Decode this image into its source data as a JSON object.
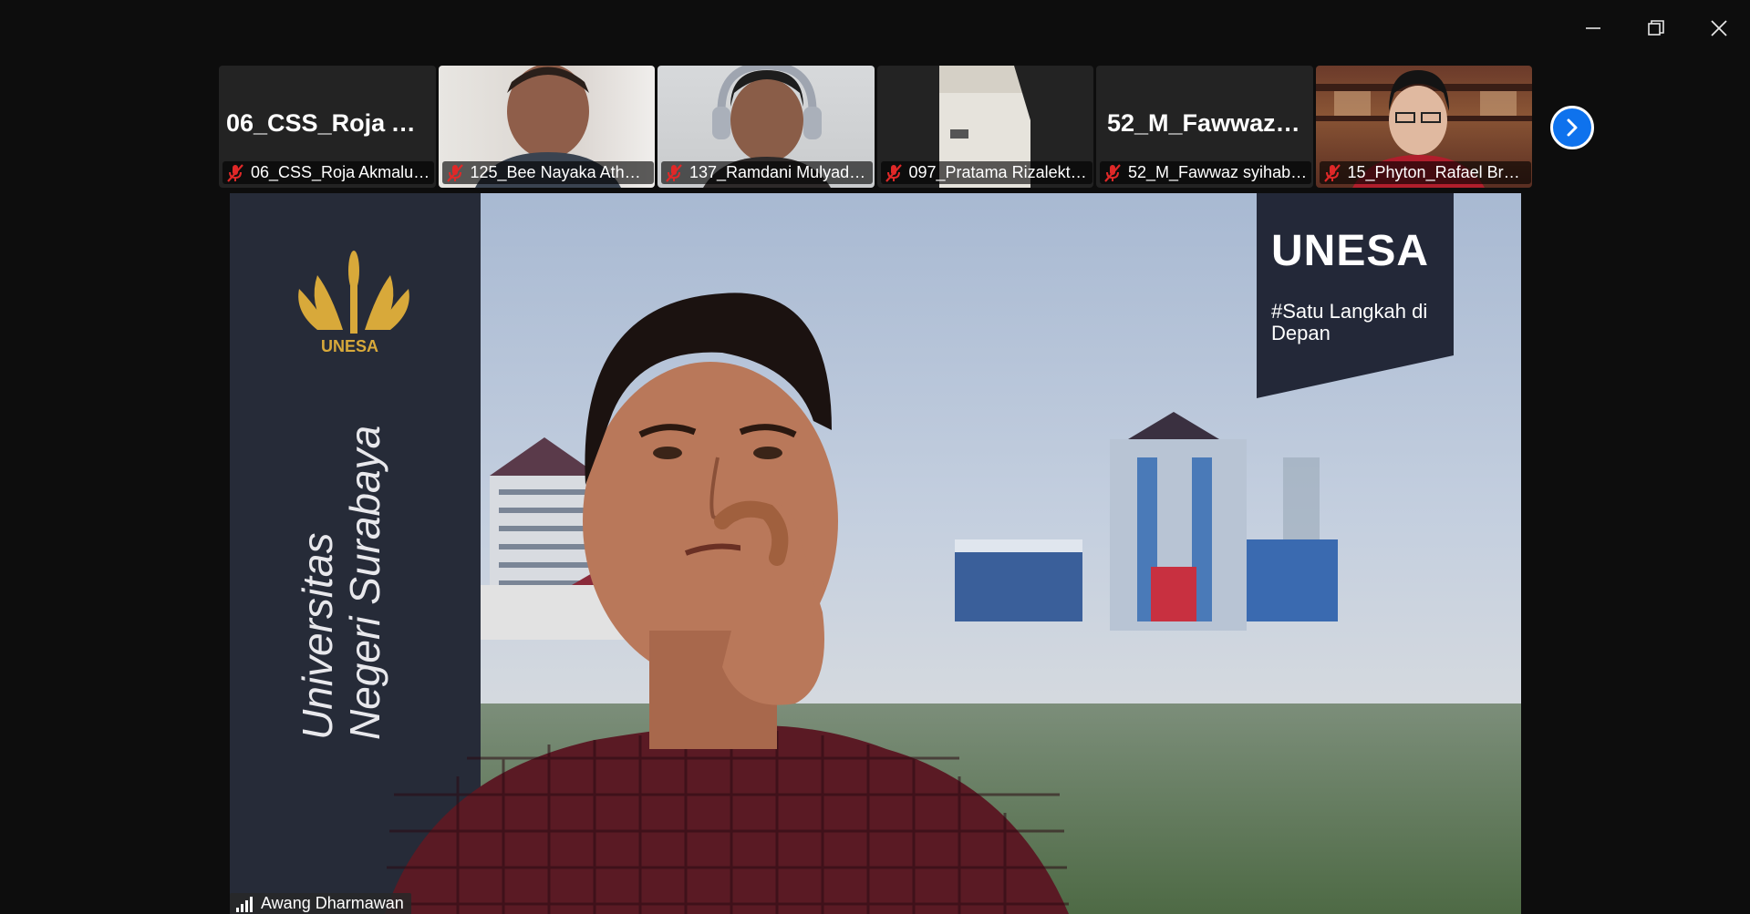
{
  "window": {
    "minimize_icon": "minimize-icon",
    "restore_icon": "restore-icon",
    "close_icon": "close-icon"
  },
  "participants": [
    {
      "big_name": "06_CSS_Roja Ak...",
      "label": "06_CSS_Roja Akmaluzz...",
      "muted": true,
      "video": false
    },
    {
      "big_name": "",
      "label": "125_Bee Nayaka Athal...",
      "muted": true,
      "video": true
    },
    {
      "big_name": "",
      "label": "137_Ramdani Mulyadi ...",
      "muted": true,
      "video": true
    },
    {
      "big_name": "",
      "label": "097_Pratama Rizalekta...",
      "muted": true,
      "video": true
    },
    {
      "big_name": "52_M_Fawwaz s...",
      "label": "52_M_Fawwaz syihab ...",
      "muted": true,
      "video": false
    },
    {
      "big_name": "",
      "label": "15_Phyton_Rafael Brya...",
      "muted": true,
      "video": true
    }
  ],
  "next_page_icon": "chevron-right-icon",
  "speaker": {
    "name": "Awang Dharmawan",
    "signal_icon": "signal-bars-icon"
  },
  "background": {
    "banner_title": "UNESA",
    "banner_tagline": "#Satu Langkah di Depan",
    "logo_text": "UNESA",
    "vertical_text_line1": "Universitas",
    "vertical_text_line2": "Negeri Surabaya"
  },
  "colors": {
    "window_bg": "#0d0d0d",
    "accent": "#0e72ed",
    "mute_red": "#e02828",
    "banner": "#232838",
    "logo_gold": "#d8a93a"
  }
}
